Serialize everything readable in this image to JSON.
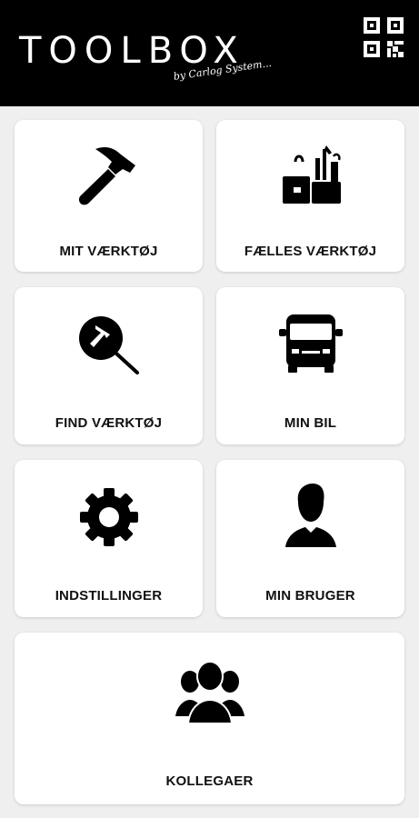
{
  "header": {
    "logo_text": "TOOLBOX",
    "tagline": "by Carlog System...",
    "background": "#000000",
    "qr_icon": "qr-code-icon"
  },
  "tiles": [
    {
      "label": "MIT VÆRKTØJ",
      "icon": "hammer-icon"
    },
    {
      "label": "FÆLLES VÆRKTØJ",
      "icon": "toolbox-icon"
    },
    {
      "label": "FIND VÆRKTØJ",
      "icon": "search-hammer-icon"
    },
    {
      "label": "MIN BIL",
      "icon": "van-icon"
    },
    {
      "label": "INDSTILLINGER",
      "icon": "gear-icon"
    },
    {
      "label": "MIN BRUGER",
      "icon": "user-icon"
    },
    {
      "label": "KOLLEGAER",
      "icon": "group-icon"
    }
  ]
}
